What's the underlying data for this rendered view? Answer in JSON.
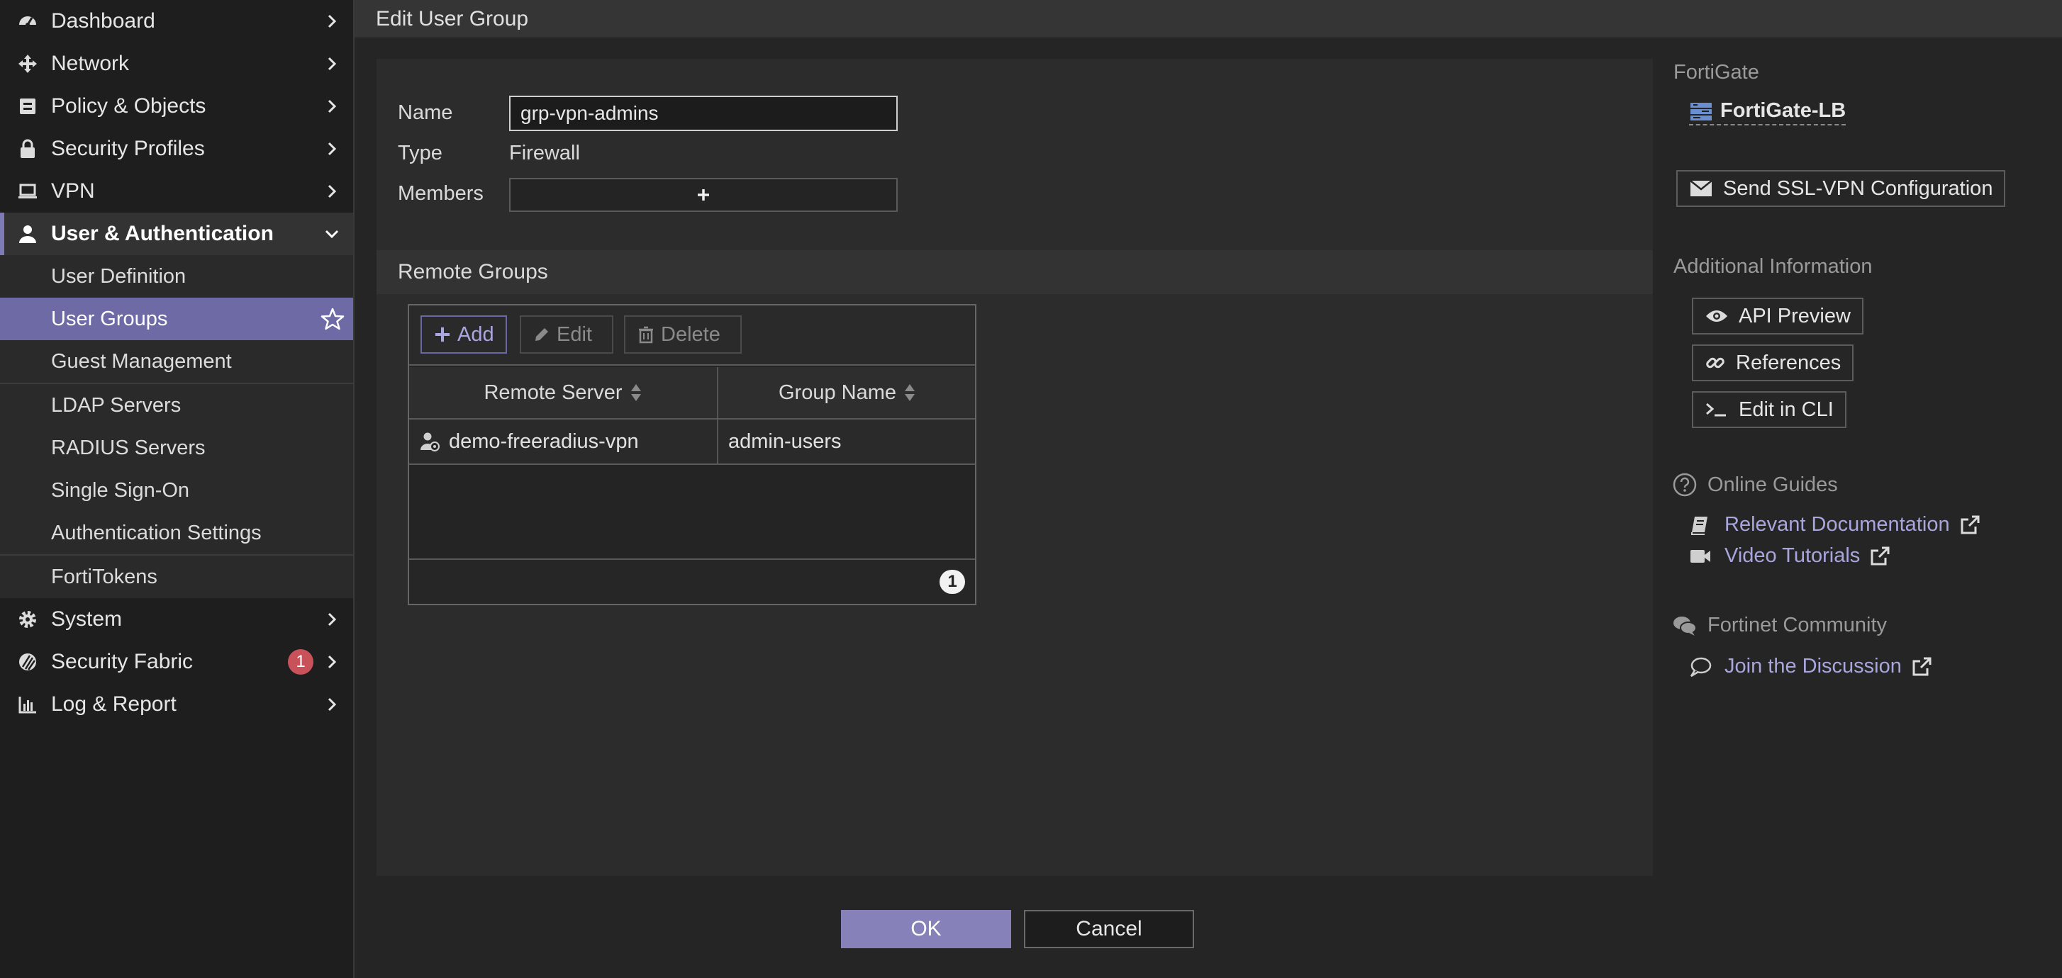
{
  "sidebar": {
    "items": [
      {
        "label": "Dashboard",
        "icon": "dashboard-icon"
      },
      {
        "label": "Network",
        "icon": "network-icon"
      },
      {
        "label": "Policy & Objects",
        "icon": "policy-icon"
      },
      {
        "label": "Security Profiles",
        "icon": "lock-icon"
      },
      {
        "label": "VPN",
        "icon": "laptop-icon"
      },
      {
        "label": "User & Authentication",
        "icon": "user-icon"
      },
      {
        "label": "System",
        "icon": "gear-icon"
      },
      {
        "label": "Security Fabric",
        "icon": "fabric-icon",
        "badge": "1"
      },
      {
        "label": "Log & Report",
        "icon": "chart-icon"
      }
    ],
    "submenu": [
      "User Definition",
      "User Groups",
      "Guest Management",
      "LDAP Servers",
      "RADIUS Servers",
      "Single Sign-On",
      "Authentication Settings",
      "FortiTokens"
    ]
  },
  "header": {
    "title": "Edit User Group"
  },
  "form": {
    "name_label": "Name",
    "name_value": "grp-vpn-admins",
    "type_label": "Type",
    "type_value": "Firewall",
    "members_label": "Members",
    "members_add": "+"
  },
  "remote_groups": {
    "title": "Remote Groups",
    "toolbar": {
      "add": "Add",
      "edit": "Edit",
      "delete": "Delete"
    },
    "columns": [
      "Remote Server",
      "Group Name"
    ],
    "rows": [
      {
        "remote_server": "demo-freeradius-vpn",
        "group_name": "admin-users"
      }
    ],
    "count": "1"
  },
  "actions": {
    "ok": "OK",
    "cancel": "Cancel"
  },
  "right_panel": {
    "device_heading": "FortiGate",
    "device_name": "FortiGate-LB",
    "send_ssl_vpn": "Send SSL-VPN Configuration",
    "additional_heading": "Additional Information",
    "api_preview": "API Preview",
    "references": "References",
    "edit_cli": "Edit in CLI",
    "guides_heading": "Online Guides",
    "relevant_docs": "Relevant Documentation",
    "video_tutorials": "Video Tutorials",
    "community_heading": "Fortinet Community",
    "join_discussion": "Join the Discussion"
  },
  "colors": {
    "accent": "#6d6aa6",
    "ok_button": "#8682b9",
    "link": "#a9a6dd",
    "badge": "#c9525a"
  }
}
